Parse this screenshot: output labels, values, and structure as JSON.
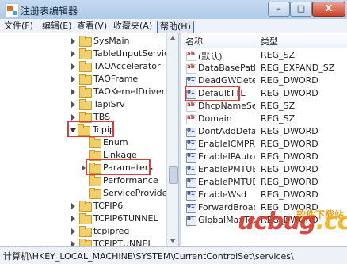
{
  "window": {
    "title": "注册表编辑器",
    "min_label": "–",
    "max_label": "□",
    "close_label": "X"
  },
  "menu": [
    "文件(F)",
    "编辑(E)",
    "查看(V)",
    "收藏夹(A)",
    "帮助(H)"
  ],
  "tree": {
    "items": [
      {
        "label": "SysMain",
        "expanded": false
      },
      {
        "label": "TabletInputService",
        "expanded": false
      },
      {
        "label": "TAOAccelerator",
        "expanded": false
      },
      {
        "label": "TAOFrame",
        "expanded": false
      },
      {
        "label": "TAOKernelDriver",
        "expanded": false
      },
      {
        "label": "TapiSrv",
        "expanded": false
      },
      {
        "label": "TBS",
        "expanded": false
      },
      {
        "label": "Tcpip",
        "expanded": true,
        "highlighted": true
      },
      {
        "label": "Enum",
        "expanded": false
      },
      {
        "label": "Linkage",
        "expanded": false
      },
      {
        "label": "Parameters",
        "expanded": false,
        "highlighted": true,
        "selected": true
      },
      {
        "label": "Performance",
        "expanded": false
      },
      {
        "label": "ServiceProvider",
        "expanded": false
      },
      {
        "label": "TCPIP6",
        "expanded": false
      },
      {
        "label": "TCPIP6TUNNEL",
        "expanded": false
      },
      {
        "label": "tcpipreg",
        "expanded": false
      },
      {
        "label": "TCPIPTUNNEL",
        "expanded": false
      }
    ]
  },
  "list": {
    "columns": {
      "name": "名称",
      "type": "类型"
    },
    "rows": [
      {
        "name": "(默认)",
        "type": "REG_SZ",
        "kind": "sz"
      },
      {
        "name": "DataBasePath",
        "type": "REG_EXPAND_SZ",
        "kind": "sz"
      },
      {
        "name": "DeadGWDetec...",
        "type": "REG_DWORD",
        "kind": "dw"
      },
      {
        "name": "DefaultTTL",
        "type": "REG_DWORD",
        "kind": "dw",
        "highlighted": true
      },
      {
        "name": "DhcpNameSer...",
        "type": "REG_SZ",
        "kind": "sz"
      },
      {
        "name": "Domain",
        "type": "REG_SZ",
        "kind": "sz"
      },
      {
        "name": "DontAddDefau...",
        "type": "REG_DWORD",
        "kind": "dw"
      },
      {
        "name": "EnableICMPRe...",
        "type": "REG_DWORD",
        "kind": "dw"
      },
      {
        "name": "EnableIPAutoC...",
        "type": "REG_DWORD",
        "kind": "dw"
      },
      {
        "name": "EnablePMTUB...",
        "type": "REG_DWORD",
        "kind": "dw"
      },
      {
        "name": "EnablePMTUDi...",
        "type": "REG_DWORD",
        "kind": "dw"
      },
      {
        "name": "EnableWsd",
        "type": "REG_DWORD",
        "kind": "dw"
      },
      {
        "name": "ForwardBroad...",
        "type": "REG_DWORD",
        "kind": "dw"
      },
      {
        "name": "GlobalMaxTcp...",
        "type": "REG_DWORD",
        "kind": "dw"
      }
    ]
  },
  "status": {
    "path": "计算机\\HKEY_LOCAL_MACHINE\\SYSTEM\\CurrentControlSet\\services\\"
  },
  "watermark": {
    "logo": "ucbug",
    "suffix": ".cc",
    "sub": "软件下载站"
  },
  "colors": {
    "highlight": "#e23a3a",
    "accent": "#3d6fb5"
  }
}
